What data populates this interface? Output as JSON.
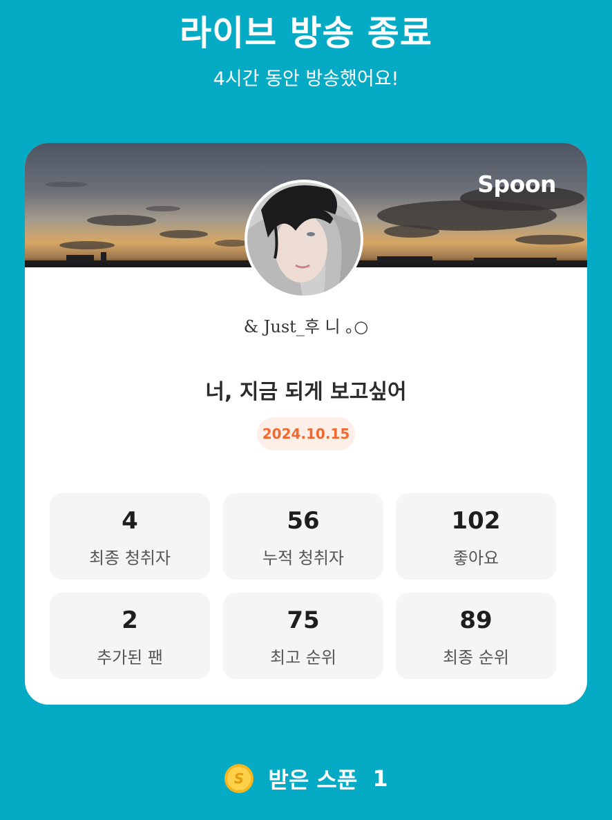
{
  "header": {
    "title": "라이브 방송 종료",
    "subtitle": "4시간 동안 방송했어요!"
  },
  "card": {
    "brand": "Spoon",
    "dj_name": "& Just_후 니 ｡○",
    "cast_title": "너, 지금 되게 보고싶어",
    "date": "2024.10.15",
    "stats": [
      {
        "value": "4",
        "label": "최종 청취자"
      },
      {
        "value": "56",
        "label": "누적 청취자"
      },
      {
        "value": "102",
        "label": "좋아요"
      },
      {
        "value": "2",
        "label": "추가된 팬"
      },
      {
        "value": "75",
        "label": "최고 순위"
      },
      {
        "value": "89",
        "label": "최종 순위"
      }
    ]
  },
  "footer": {
    "label": "받은 스푼",
    "count": "1",
    "coin_glyph": "S",
    "coin_icon": "spoon-coin-icon"
  },
  "colors": {
    "background": "#05AAC4",
    "date_pill_bg": "#FDEEE7",
    "date_pill_text": "#F0692F",
    "stat_bg": "#F5F5F5"
  }
}
